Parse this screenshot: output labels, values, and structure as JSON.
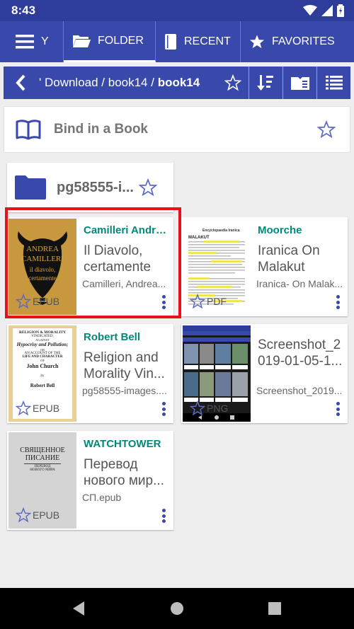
{
  "status": {
    "time": "8:43"
  },
  "tabs": [
    {
      "label": "Y",
      "icon": "menu-icon"
    },
    {
      "label": "FOLDER",
      "icon": "folder-open-icon"
    },
    {
      "label": "RECENT",
      "icon": "recent-file-icon"
    },
    {
      "label": "FAVORITES",
      "icon": "star-icon"
    }
  ],
  "path": {
    "prefix": "' Download / book14 / ",
    "current": "book14"
  },
  "bind": {
    "label": "Bind in a Book"
  },
  "folder": {
    "name": "pg58555-i..."
  },
  "books": [
    {
      "author": "Camilleri Andrea...",
      "title": "Il Diavolo, certamente",
      "file": "Camilleri, Andrea...",
      "format": "EPUB",
      "cover": {
        "name": "ANDREA CAMILLERI",
        "subtitle": "il diavolo, certamente"
      }
    },
    {
      "author": "Moorche",
      "title": "Iranica On Malakut",
      "file": "Iranica- On Malak...",
      "format": "PDF",
      "cover": {
        "header": "Encyclopaedia Iranica",
        "heading": "MALAKUT"
      }
    },
    {
      "author": "Robert Bell",
      "title": "Religion and Morality Vin...",
      "file": "pg58555-images....",
      "format": "EPUB",
      "cover": {
        "l1": "RELIGION & MORALITY",
        "l2": "VINDICATED,",
        "l3": "AGAINST",
        "l4": "Hypocrisy and Pollution;",
        "l5": "OR",
        "l6": "AN ACCOUNT OF THE",
        "l7": "LIFE AND CHARACTER",
        "l8": "OF",
        "l9": "John Church",
        "l10": "by",
        "l11": "Robert Bell"
      }
    },
    {
      "author": "",
      "title": "Screenshot_2 019-01-05-1...",
      "file": "Screenshot_2019...",
      "format": "PNG"
    },
    {
      "author": "WATCHTOWER",
      "title": "Перевод нового мир...",
      "file": "СП.epub",
      "format": "EPUB",
      "cover": {
        "l1": "СВЯЩЕННОЕ",
        "l2": "ПИСАНИЕ",
        "l3": "ПЕРЕВОД",
        "l4": "НОВОГО МИРА"
      }
    }
  ],
  "colors": {
    "primary": "#3949ab",
    "status": "#2f3d9a",
    "author": "#00897b",
    "highlight": "#e8101a"
  }
}
